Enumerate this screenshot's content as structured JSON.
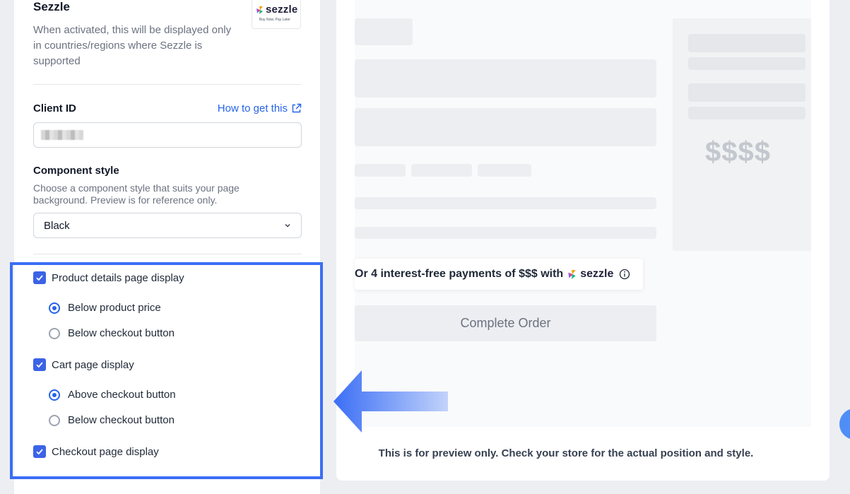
{
  "provider": {
    "name": "Sezzle",
    "description": "When activated, this will be displayed only in countries/regions where Sezzle is supported",
    "logo_text": "sezzle",
    "logo_tagline": "Buy Now, Pay Later"
  },
  "client_id": {
    "label": "Client ID",
    "help_link": "How to get this"
  },
  "component_style": {
    "label": "Component style",
    "hint": "Choose a component style that suits your page background. Preview is for reference only.",
    "selected": "Black"
  },
  "options": {
    "product_details": {
      "label": "Product details page display",
      "checked": true,
      "radios": [
        "Below product price",
        "Below checkout button"
      ],
      "selected_index": 0
    },
    "cart_page": {
      "label": "Cart page display",
      "checked": true,
      "radios": [
        "Above checkout button",
        "Below checkout button"
      ],
      "selected_index": 0
    },
    "checkout_page": {
      "label": "Checkout page display",
      "checked": true
    }
  },
  "preview": {
    "price_placeholder": "$$$$",
    "promo_text": "Or 4 interest-free payments of $$$ with",
    "promo_brand": "sezzle",
    "complete_order": "Complete Order",
    "note": "This is for preview only. Check your store for the actual position and style."
  },
  "colors": {
    "accent": "#3b63e6",
    "link": "#2563eb",
    "highlight_border": "#3b6ef5"
  }
}
